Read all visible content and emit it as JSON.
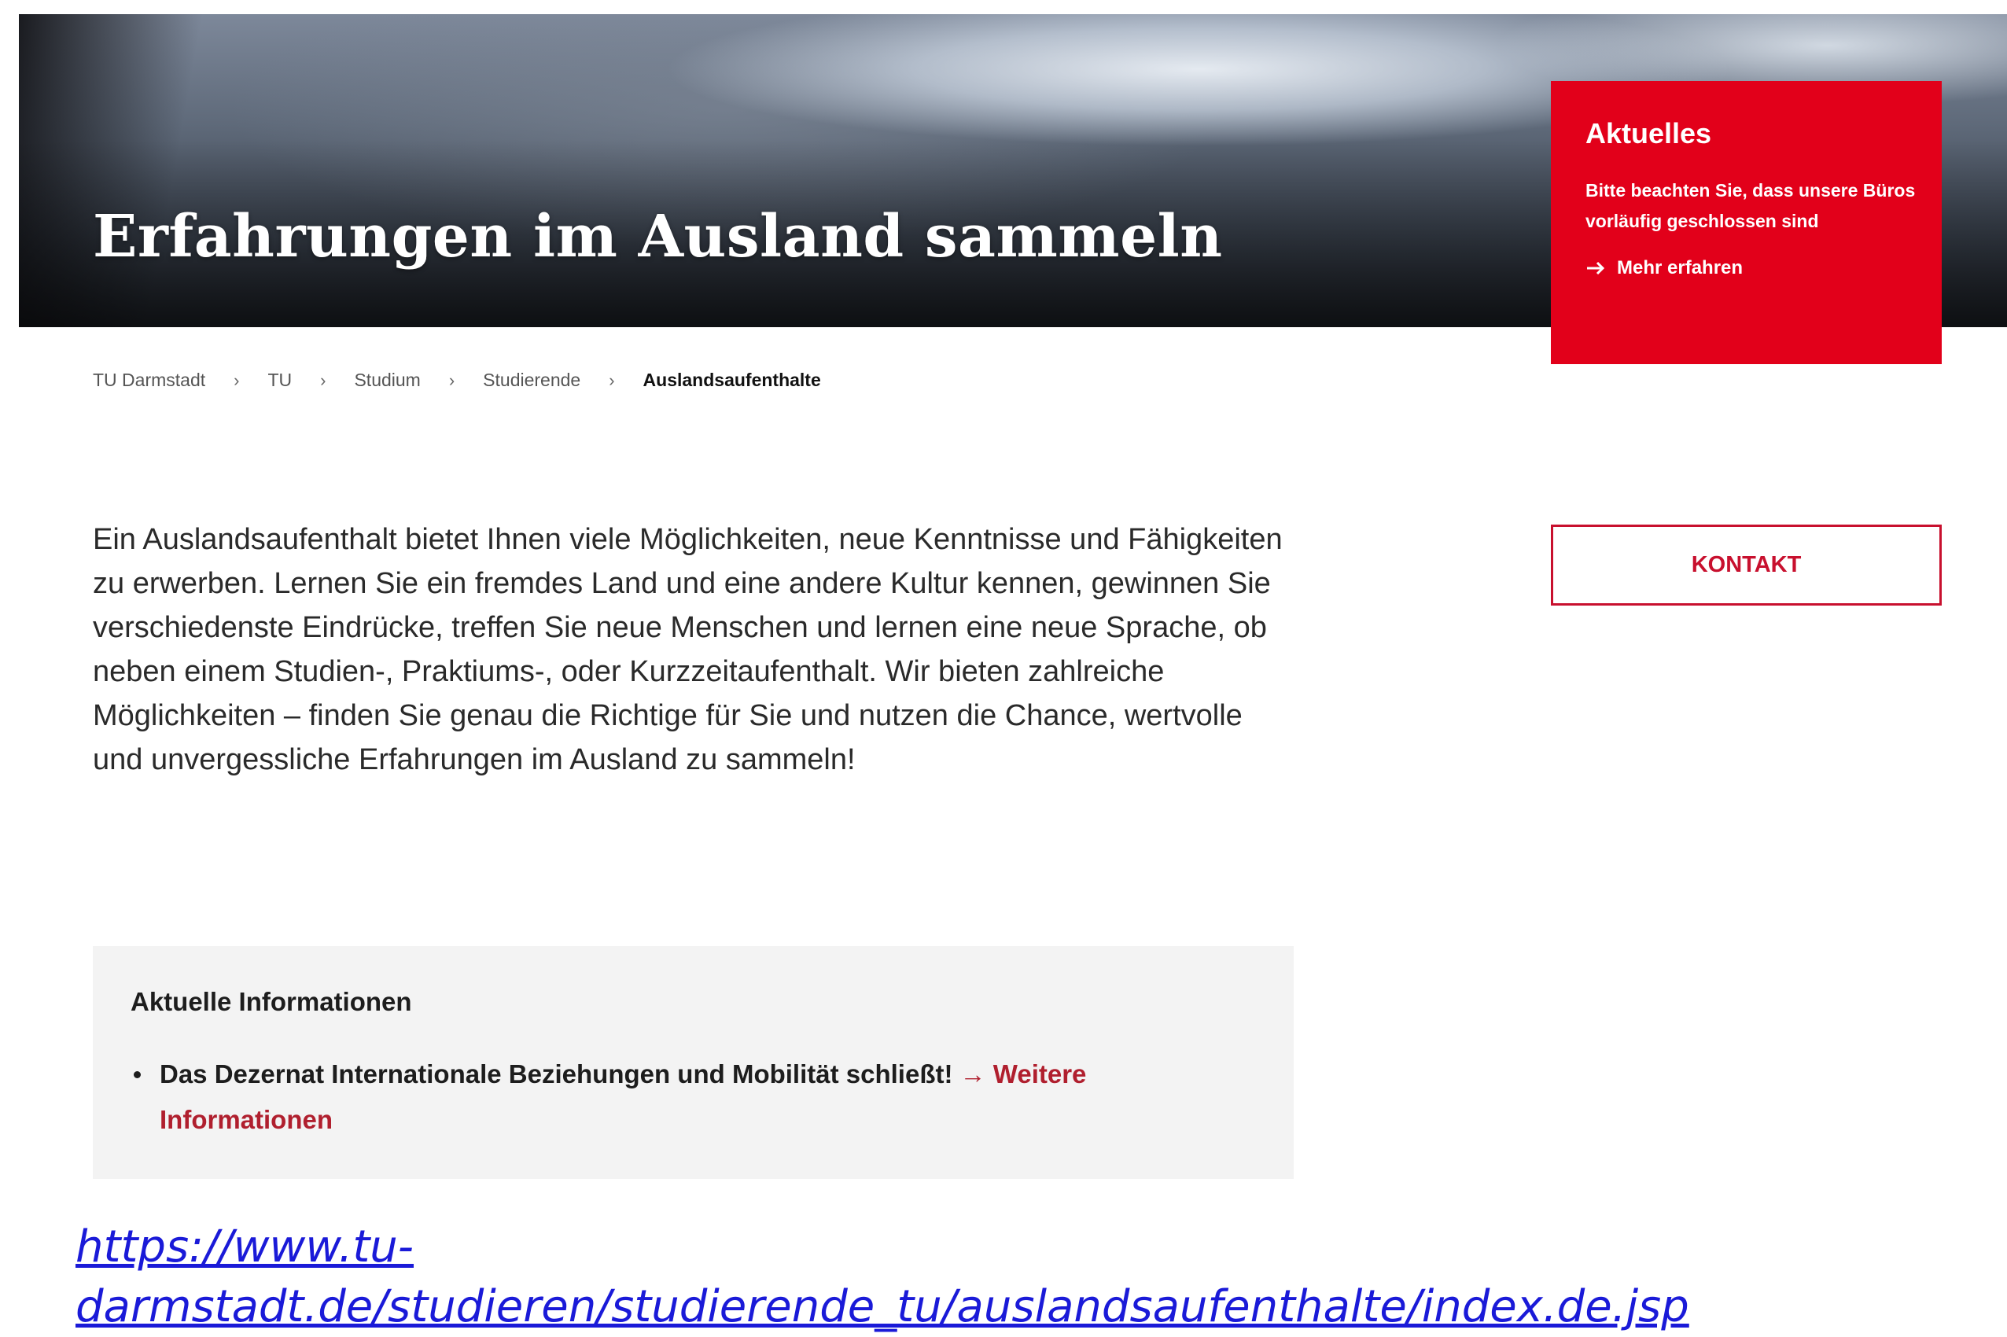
{
  "hero": {
    "title": "Erfahrungen im Ausland sammeln"
  },
  "news": {
    "heading": "Aktuelles",
    "text": "Bitte beachten Sie, dass unsere Büros vorläufig geschlossen sind",
    "link_label": "Mehr erfahren",
    "link_icon": "arrow-right-icon",
    "background_color": "#e2001a"
  },
  "breadcrumb": {
    "items": [
      "TU Darmstadt",
      "TU",
      "Studium",
      "Studierende",
      "Auslandsaufenthalte"
    ],
    "separator": "›"
  },
  "intro": {
    "text": "Ein Auslandsaufenthalt bietet Ihnen viele Möglichkeiten, neue Kenntnisse und Fähigkeiten zu erwerben. Lernen Sie ein fremdes Land und eine andere Kultur kennen, gewinnen Sie verschiedenste Eindrücke, treffen Sie neue Menschen und lernen eine neue Sprache, ob neben einem Studien-, Praktiums-, oder Kurzzeitaufenthalt. Wir bieten zahlreiche Möglichkeiten – finden Sie genau die Richtige für Sie und nutzen die Chance, wertvolle und unvergessliche Erfahrungen im Ausland zu sammeln!"
  },
  "contact": {
    "label": "KONTAKT",
    "accent_color": "#c8102e"
  },
  "info": {
    "heading": "Aktuelle Informationen",
    "item_text": "Das Dezernat Internationale Beziehungen und Mobilität schließt!",
    "item_link_arrow": "→",
    "item_link": "Weitere Informationen"
  },
  "url": {
    "text": "https://www.tu-darmstadt.de/studieren/studierende_tu/auslandsaufenthalte/index.de.jsp"
  }
}
